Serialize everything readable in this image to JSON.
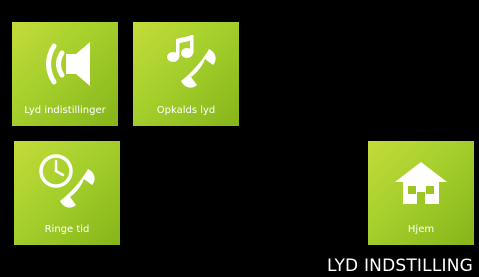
{
  "screen": {
    "title": "LYD INDSTILLING"
  },
  "tiles": [
    {
      "id": "lyd",
      "label": "Lyd indistillinger",
      "icon": "speaker-icon"
    },
    {
      "id": "opkald",
      "label": "Opkalds lyd",
      "icon": "phone-music-icon"
    },
    {
      "id": "ringe",
      "label": "Ringe tid",
      "icon": "phone-clock-icon"
    },
    {
      "id": "hjem",
      "label": "Hjem",
      "icon": "home-icon"
    }
  ],
  "colors": {
    "background": "#000000",
    "tile_light": "#c4dc3a",
    "tile_dark": "#86b51a",
    "text": "#ffffff"
  }
}
